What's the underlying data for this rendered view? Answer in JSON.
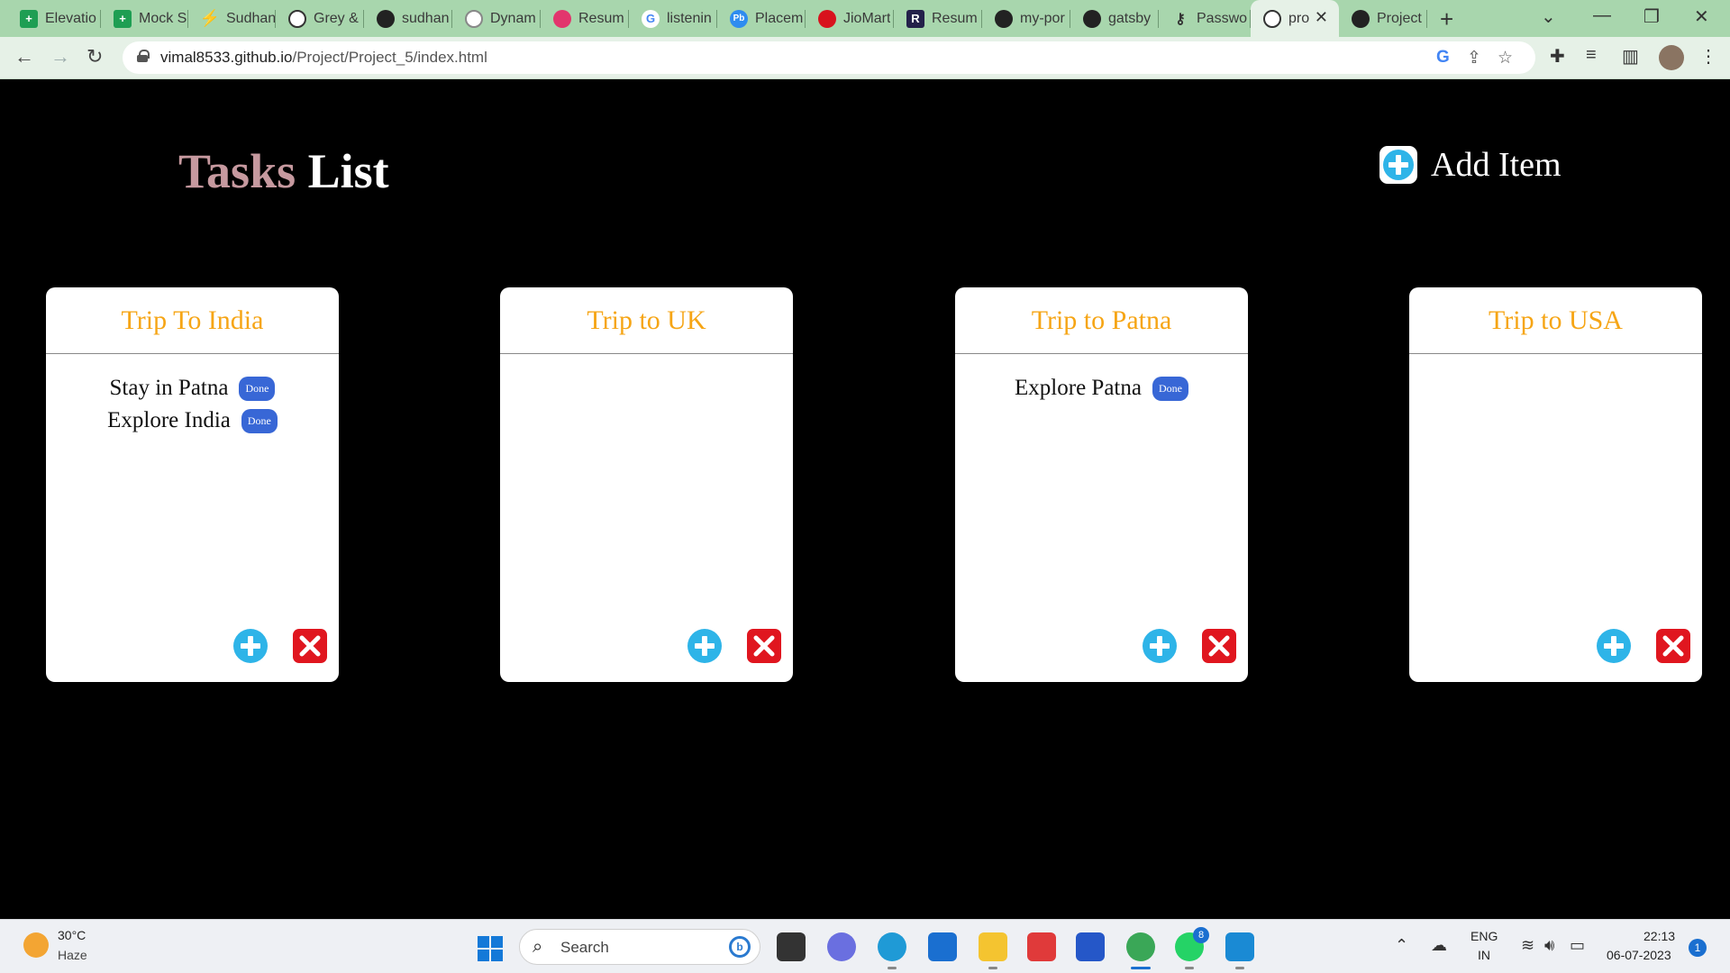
{
  "browser": {
    "tabs": [
      {
        "label": "Elevatio",
        "icon": "sheets-icon"
      },
      {
        "label": "Mock S",
        "icon": "sheets-icon"
      },
      {
        "label": "Sudhan",
        "icon": "bolt-icon"
      },
      {
        "label": "Grey &",
        "icon": "globe-icon"
      },
      {
        "label": "sudhan",
        "icon": "github-icon"
      },
      {
        "label": "Dynam",
        "icon": "dynamic-icon"
      },
      {
        "label": "Resum",
        "icon": "resume-icon"
      },
      {
        "label": "listenin",
        "icon": "google-icon"
      },
      {
        "label": "Placem",
        "icon": "placement-icon"
      },
      {
        "label": "JioMart",
        "icon": "jiomart-icon"
      },
      {
        "label": "Resum",
        "icon": "resume-r-icon"
      },
      {
        "label": "my-por",
        "icon": "github-icon"
      },
      {
        "label": "gatsby",
        "icon": "github-icon"
      },
      {
        "label": "Passwo",
        "icon": "key-icon"
      },
      {
        "label": "pro",
        "icon": "globe-icon",
        "active": true
      },
      {
        "label": "Project",
        "icon": "github-icon"
      }
    ],
    "url_host": "vimal8533.github.io",
    "url_path": "/Project/Project_5/index.html"
  },
  "header": {
    "title_part1": "Tasks",
    "title_part2": "List",
    "add_item_label": "Add Item"
  },
  "cards": [
    {
      "title": "Trip To India",
      "tasks": [
        {
          "text": "Stay in Patna",
          "button": "Done"
        },
        {
          "text": "Explore India",
          "button": "Done"
        }
      ]
    },
    {
      "title": "Trip to UK",
      "tasks": []
    },
    {
      "title": "Trip to Patna",
      "tasks": [
        {
          "text": "Explore Patna",
          "button": "Done"
        }
      ]
    },
    {
      "title": "Trip to USA",
      "tasks": []
    }
  ],
  "taskbar": {
    "temperature": "30°C",
    "condition": "Haze",
    "search_placeholder": "Search",
    "whatsapp_badge": "8",
    "lang_top": "ENG",
    "lang_bottom": "IN",
    "time": "22:13",
    "date": "06-07-2023",
    "notifications": "1"
  },
  "colors": {
    "title_accent": "#c6999f",
    "card_title": "#f6a515",
    "done_button": "#3867d6",
    "plus_icon": "#2eb4e8",
    "delete_icon": "#e0161f",
    "tabbar_bg": "#a8d6ad"
  }
}
